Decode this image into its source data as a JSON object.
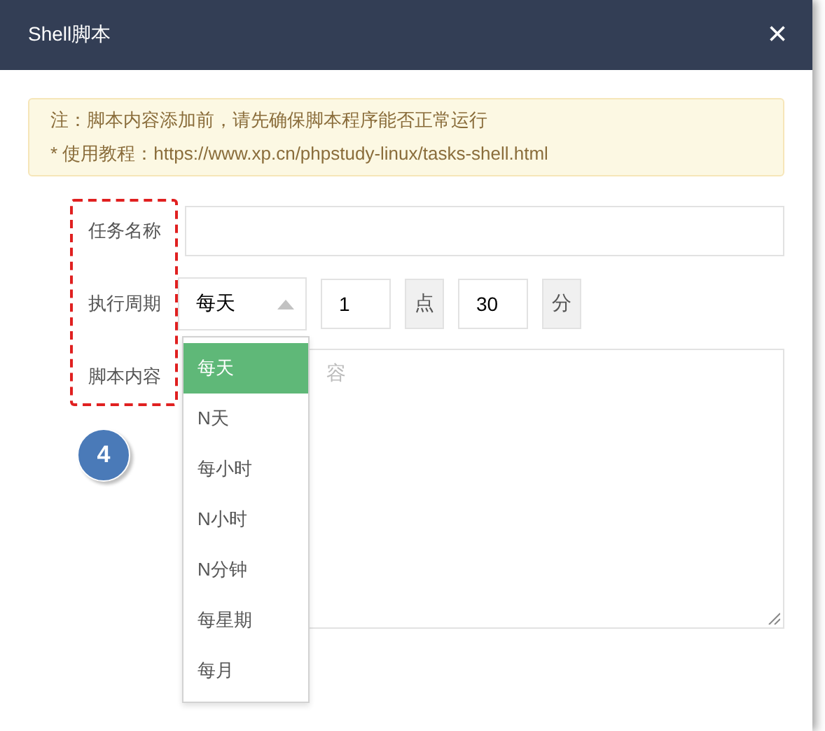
{
  "window": {
    "title": "Shell脚本",
    "close": "×"
  },
  "notice": {
    "lines": [
      "注：脚本内容添加前，请先确保脚本程序能否正常运行",
      "* 使用教程：https://www.xp.cn/phpstudy-linux/tasks-shell.html"
    ]
  },
  "form": {
    "name_label": "任务名称",
    "period_label": "执行周期",
    "content_label": "脚本内容",
    "period": {
      "value": "每天",
      "hour": "1",
      "hour_unit": "点",
      "minute": "30",
      "minute_unit": "分"
    },
    "content_placeholder": "容"
  },
  "dropdown": {
    "options": [
      {
        "label": "每天",
        "selected": true
      },
      {
        "label": "N天",
        "selected": false
      },
      {
        "label": "每小时",
        "selected": false
      },
      {
        "label": "N小时",
        "selected": false
      },
      {
        "label": "N分钟",
        "selected": false
      },
      {
        "label": "每星期",
        "selected": false
      },
      {
        "label": "每月",
        "selected": false
      }
    ]
  },
  "step_badge": "4"
}
